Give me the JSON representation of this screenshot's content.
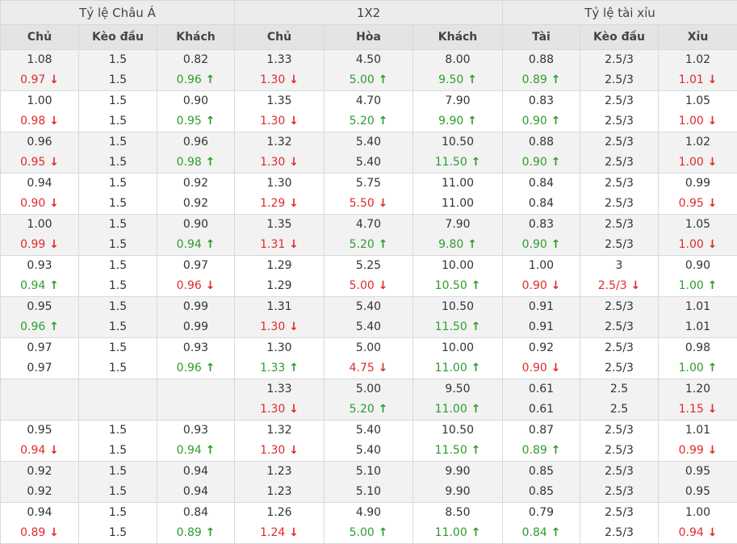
{
  "groups": [
    "Tỷ lệ Châu Á",
    "1X2",
    "Tỷ lệ tài xỉu"
  ],
  "columns": [
    "Chủ",
    "Kèo đầu",
    "Khách",
    "Chủ",
    "Hòa",
    "Khách",
    "Tài",
    "Kèo đầu",
    "Xỉu"
  ],
  "rows": [
    [
      [
        "1.08",
        [
          "0.97",
          "down"
        ]
      ],
      [
        "1.5",
        [
          "1.5",
          ""
        ]
      ],
      [
        "0.82",
        [
          "0.96",
          "up"
        ]
      ],
      [
        "1.33",
        [
          "1.30",
          "down"
        ]
      ],
      [
        "4.50",
        [
          "5.00",
          "up"
        ]
      ],
      [
        "8.00",
        [
          "9.50",
          "up"
        ]
      ],
      [
        "0.88",
        [
          "0.89",
          "up"
        ]
      ],
      [
        "2.5/3",
        [
          "2.5/3",
          ""
        ]
      ],
      [
        "1.02",
        [
          "1.01",
          "down"
        ]
      ]
    ],
    [
      [
        "1.00",
        [
          "0.98",
          "down"
        ]
      ],
      [
        "1.5",
        [
          "1.5",
          ""
        ]
      ],
      [
        "0.90",
        [
          "0.95",
          "up"
        ]
      ],
      [
        "1.35",
        [
          "1.30",
          "down"
        ]
      ],
      [
        "4.70",
        [
          "5.20",
          "up"
        ]
      ],
      [
        "7.90",
        [
          "9.90",
          "up"
        ]
      ],
      [
        "0.83",
        [
          "0.90",
          "up"
        ]
      ],
      [
        "2.5/3",
        [
          "2.5/3",
          ""
        ]
      ],
      [
        "1.05",
        [
          "1.00",
          "down"
        ]
      ]
    ],
    [
      [
        "0.96",
        [
          "0.95",
          "down"
        ]
      ],
      [
        "1.5",
        [
          "1.5",
          ""
        ]
      ],
      [
        "0.96",
        [
          "0.98",
          "up"
        ]
      ],
      [
        "1.32",
        [
          "1.30",
          "down"
        ]
      ],
      [
        "5.40",
        [
          "5.40",
          ""
        ]
      ],
      [
        "10.50",
        [
          "11.50",
          "up"
        ]
      ],
      [
        "0.88",
        [
          "0.90",
          "up"
        ]
      ],
      [
        "2.5/3",
        [
          "2.5/3",
          ""
        ]
      ],
      [
        "1.02",
        [
          "1.00",
          "down"
        ]
      ]
    ],
    [
      [
        "0.94",
        [
          "0.90",
          "down"
        ]
      ],
      [
        "1.5",
        [
          "1.5",
          ""
        ]
      ],
      [
        "0.92",
        [
          "0.92",
          ""
        ]
      ],
      [
        "1.30",
        [
          "1.29",
          "down"
        ]
      ],
      [
        "5.75",
        [
          "5.50",
          "down"
        ]
      ],
      [
        "11.00",
        [
          "11.00",
          ""
        ]
      ],
      [
        "0.84",
        [
          "0.84",
          ""
        ]
      ],
      [
        "2.5/3",
        [
          "2.5/3",
          ""
        ]
      ],
      [
        "0.99",
        [
          "0.95",
          "down"
        ]
      ]
    ],
    [
      [
        "1.00",
        [
          "0.99",
          "down"
        ]
      ],
      [
        "1.5",
        [
          "1.5",
          ""
        ]
      ],
      [
        "0.90",
        [
          "0.94",
          "up"
        ]
      ],
      [
        "1.35",
        [
          "1.31",
          "down"
        ]
      ],
      [
        "4.70",
        [
          "5.20",
          "up"
        ]
      ],
      [
        "7.90",
        [
          "9.80",
          "up"
        ]
      ],
      [
        "0.83",
        [
          "0.90",
          "up"
        ]
      ],
      [
        "2.5/3",
        [
          "2.5/3",
          ""
        ]
      ],
      [
        "1.05",
        [
          "1.00",
          "down"
        ]
      ]
    ],
    [
      [
        "0.93",
        [
          "0.94",
          "up"
        ]
      ],
      [
        "1.5",
        [
          "1.5",
          ""
        ]
      ],
      [
        "0.97",
        [
          "0.96",
          "down"
        ]
      ],
      [
        "1.29",
        [
          "1.29",
          ""
        ]
      ],
      [
        "5.25",
        [
          "5.00",
          "down"
        ]
      ],
      [
        "10.00",
        [
          "10.50",
          "up"
        ]
      ],
      [
        "1.00",
        [
          "0.90",
          "down"
        ]
      ],
      [
        "3",
        [
          "2.5/3",
          "down"
        ]
      ],
      [
        "0.90",
        [
          "1.00",
          "up"
        ]
      ]
    ],
    [
      [
        "0.95",
        [
          "0.96",
          "up"
        ]
      ],
      [
        "1.5",
        [
          "1.5",
          ""
        ]
      ],
      [
        "0.99",
        [
          "0.99",
          ""
        ]
      ],
      [
        "1.31",
        [
          "1.30",
          "down"
        ]
      ],
      [
        "5.40",
        [
          "5.40",
          ""
        ]
      ],
      [
        "10.50",
        [
          "11.50",
          "up"
        ]
      ],
      [
        "0.91",
        [
          "0.91",
          ""
        ]
      ],
      [
        "2.5/3",
        [
          "2.5/3",
          ""
        ]
      ],
      [
        "1.01",
        [
          "1.01",
          ""
        ]
      ]
    ],
    [
      [
        "0.97",
        [
          "0.97",
          ""
        ]
      ],
      [
        "1.5",
        [
          "1.5",
          ""
        ]
      ],
      [
        "0.93",
        [
          "0.96",
          "up"
        ]
      ],
      [
        "1.30",
        [
          "1.33",
          "up"
        ]
      ],
      [
        "5.00",
        [
          "4.75",
          "down"
        ]
      ],
      [
        "10.00",
        [
          "11.00",
          "up"
        ]
      ],
      [
        "0.92",
        [
          "0.90",
          "down"
        ]
      ],
      [
        "2.5/3",
        [
          "2.5/3",
          ""
        ]
      ],
      [
        "0.98",
        [
          "1.00",
          "up"
        ]
      ]
    ],
    [
      [
        "",
        [
          "",
          ""
        ]
      ],
      [
        "",
        [
          "",
          ""
        ]
      ],
      [
        "",
        [
          "",
          ""
        ]
      ],
      [
        "1.33",
        [
          "1.30",
          "down"
        ]
      ],
      [
        "5.00",
        [
          "5.20",
          "up"
        ]
      ],
      [
        "9.50",
        [
          "11.00",
          "up"
        ]
      ],
      [
        "0.61",
        [
          "0.61",
          ""
        ]
      ],
      [
        "2.5",
        [
          "2.5",
          ""
        ]
      ],
      [
        "1.20",
        [
          "1.15",
          "down"
        ]
      ]
    ],
    [
      [
        "0.95",
        [
          "0.94",
          "down"
        ]
      ],
      [
        "1.5",
        [
          "1.5",
          ""
        ]
      ],
      [
        "0.93",
        [
          "0.94",
          "up"
        ]
      ],
      [
        "1.32",
        [
          "1.30",
          "down"
        ]
      ],
      [
        "5.40",
        [
          "5.40",
          ""
        ]
      ],
      [
        "10.50",
        [
          "11.50",
          "up"
        ]
      ],
      [
        "0.87",
        [
          "0.89",
          "up"
        ]
      ],
      [
        "2.5/3",
        [
          "2.5/3",
          ""
        ]
      ],
      [
        "1.01",
        [
          "0.99",
          "down"
        ]
      ]
    ],
    [
      [
        "0.92",
        [
          "0.92",
          ""
        ]
      ],
      [
        "1.5",
        [
          "1.5",
          ""
        ]
      ],
      [
        "0.94",
        [
          "0.94",
          ""
        ]
      ],
      [
        "1.23",
        [
          "1.23",
          ""
        ]
      ],
      [
        "5.10",
        [
          "5.10",
          ""
        ]
      ],
      [
        "9.90",
        [
          "9.90",
          ""
        ]
      ],
      [
        "0.85",
        [
          "0.85",
          ""
        ]
      ],
      [
        "2.5/3",
        [
          "2.5/3",
          ""
        ]
      ],
      [
        "0.95",
        [
          "0.95",
          ""
        ]
      ]
    ],
    [
      [
        "0.94",
        [
          "0.89",
          "down"
        ]
      ],
      [
        "1.5",
        [
          "1.5",
          ""
        ]
      ],
      [
        "0.84",
        [
          "0.89",
          "up"
        ]
      ],
      [
        "1.26",
        [
          "1.24",
          "down"
        ]
      ],
      [
        "4.90",
        [
          "5.00",
          "up"
        ]
      ],
      [
        "8.50",
        [
          "11.00",
          "up"
        ]
      ],
      [
        "0.79",
        [
          "0.84",
          "up"
        ]
      ],
      [
        "2.5/3",
        [
          "2.5/3",
          ""
        ]
      ],
      [
        "1.00",
        [
          "0.94",
          "down"
        ]
      ]
    ]
  ]
}
